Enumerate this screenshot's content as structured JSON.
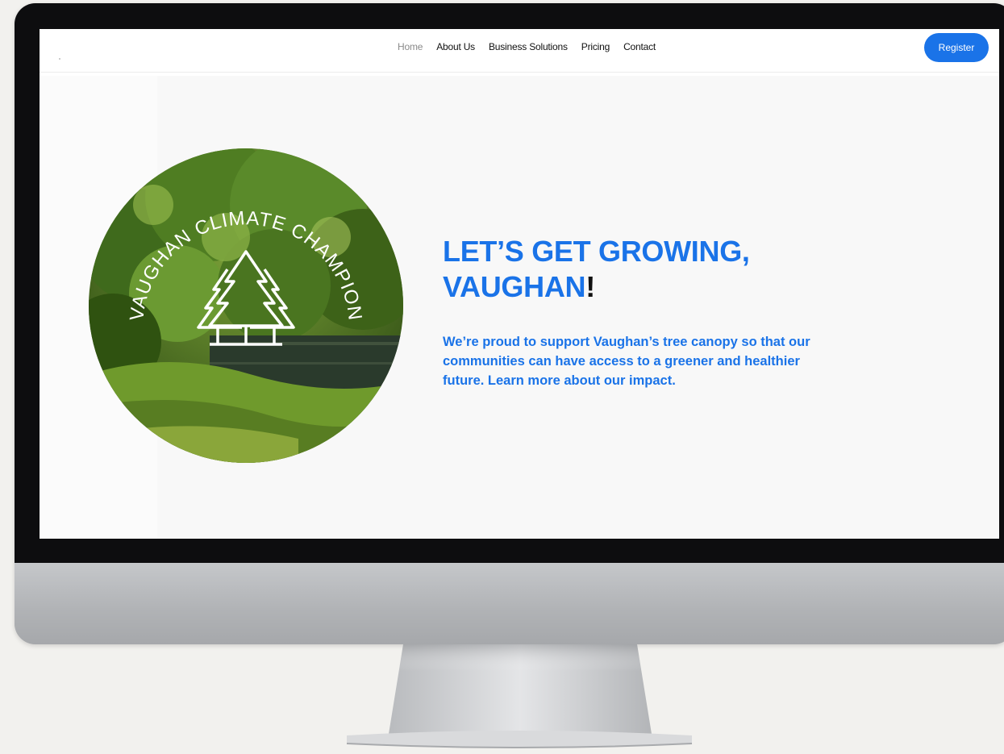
{
  "nav": {
    "items": [
      {
        "label": "Home",
        "active": true
      },
      {
        "label": "About Us",
        "active": false
      },
      {
        "label": "Business Solutions",
        "active": false
      },
      {
        "label": "Pricing",
        "active": false
      },
      {
        "label": "Contact",
        "active": false
      }
    ],
    "register_label": "Register"
  },
  "badge": {
    "text": "VAUGHAN CLIMATE CHAMPION",
    "icon": "three-pine-trees-icon"
  },
  "hero": {
    "title_line1": "LET’S GET GROWING,",
    "title_line2": "VAUGHAN",
    "title_punct": "!",
    "body": "We’re proud to support Vaughan’s tree canopy so that our communities can have access to a greener and healthier future. Learn more about our impact."
  },
  "colors": {
    "accent": "#1a73e8",
    "bezel": "#0d0d0f",
    "page_bg": "#f2f1ee"
  }
}
